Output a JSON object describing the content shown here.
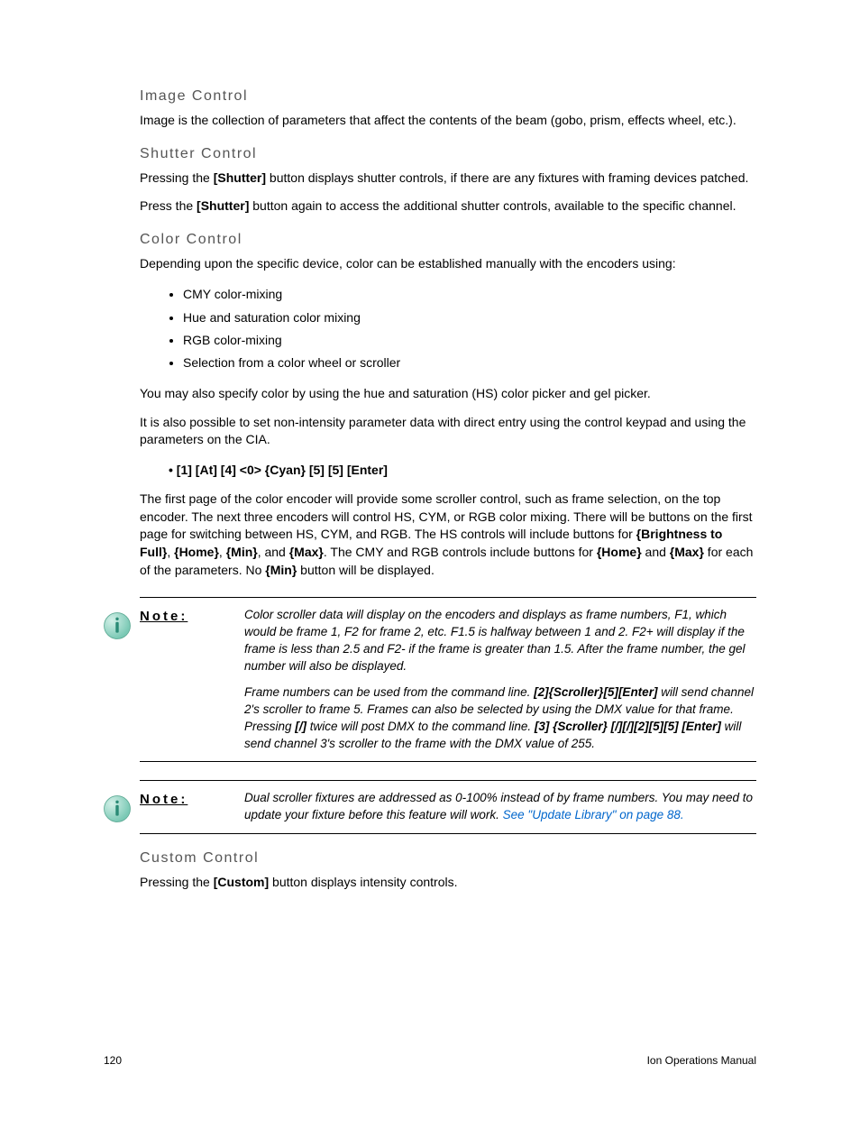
{
  "sections": {
    "image": {
      "heading": "Image Control",
      "p1": "Image is the collection of parameters that affect the contents of the beam (gobo, prism, effects wheel, etc.)."
    },
    "shutter": {
      "heading": "Shutter Control",
      "p1_a": "Pressing the ",
      "p1_b": "[Shutter]",
      "p1_c": " button displays shutter controls, if there are any fixtures with framing devices patched.",
      "p2_a": "Press the ",
      "p2_b": "[Shutter]",
      "p2_c": " button again to access the additional shutter controls, available to the specific channel."
    },
    "color": {
      "heading": "Color Control",
      "intro": "Depending upon the specific device, color can be established manually with the encoders using:",
      "items": [
        "CMY color-mixing",
        "Hue and saturation color mixing",
        "RGB color-mixing",
        "Selection from a color wheel or scroller"
      ],
      "p2": "You may also specify color by using the hue and saturation (HS) color picker and gel picker.",
      "p3": "It is also possible to set non-intensity parameter data with direct entry using the control keypad and using the parameters on the CIA.",
      "cmd": "[1] [At] [4] <0> {Cyan} [5] [5] [Enter]",
      "p4_a": "The first page of the color encoder will provide some scroller control, such as frame selection, on the top encoder. The next three encoders will control HS, CYM, or RGB color mixing. There will be buttons on the first page for switching between HS, CYM, and RGB. The HS controls will include buttons for ",
      "p4_b1": "{Brightness to Full}",
      "p4_b2": "{Home}",
      "p4_b3": "{Min}",
      "p4_b4": "{Max}",
      "p4_c": ". The CMY and RGB controls include buttons for ",
      "p4_b5": "{Home}",
      "p4_d": " and ",
      "p4_b6": "{Max}",
      "p4_e": " for each of the parameters. No ",
      "p4_b7": "{Min}",
      "p4_f": " button will be displayed."
    },
    "note1": {
      "label": "Note:",
      "p1": "Color scroller data will display on the encoders and displays as frame numbers, F1, which would be frame 1, F2 for frame 2, etc. F1.5 is halfway between 1 and 2. F2+ will display if the frame is less than 2.5 and F2- if the frame is greater than 1.5. After the frame number, the gel number will also be displayed.",
      "p2_a": "Frame numbers can be used from the command line. ",
      "p2_b1": "[2]{Scroller}[5][Enter]",
      "p2_c": " will send channel 2's scroller to frame 5. Frames can also be selected by using the DMX value for that frame. Pressing ",
      "p2_b2": "[/]",
      "p2_d": " twice will post DMX to the command line. ",
      "p2_b3": "[3] {Scroller} [/][/][2][5][5] [Enter]",
      "p2_e": " will send channel 3's scroller to the frame with the DMX value of 255."
    },
    "note2": {
      "label": "Note:",
      "p1_a": "Dual scroller fixtures are addressed as 0-100% instead of by frame numbers. You may need to update your fixture before this feature will work. ",
      "p1_link": "See \"Update Library\" on page 88."
    },
    "custom": {
      "heading": "Custom Control",
      "p1_a": "Pressing the ",
      "p1_b": "[Custom]",
      "p1_c": " button displays intensity controls."
    }
  },
  "footer": {
    "page": "120",
    "title": "Ion Operations Manual"
  }
}
